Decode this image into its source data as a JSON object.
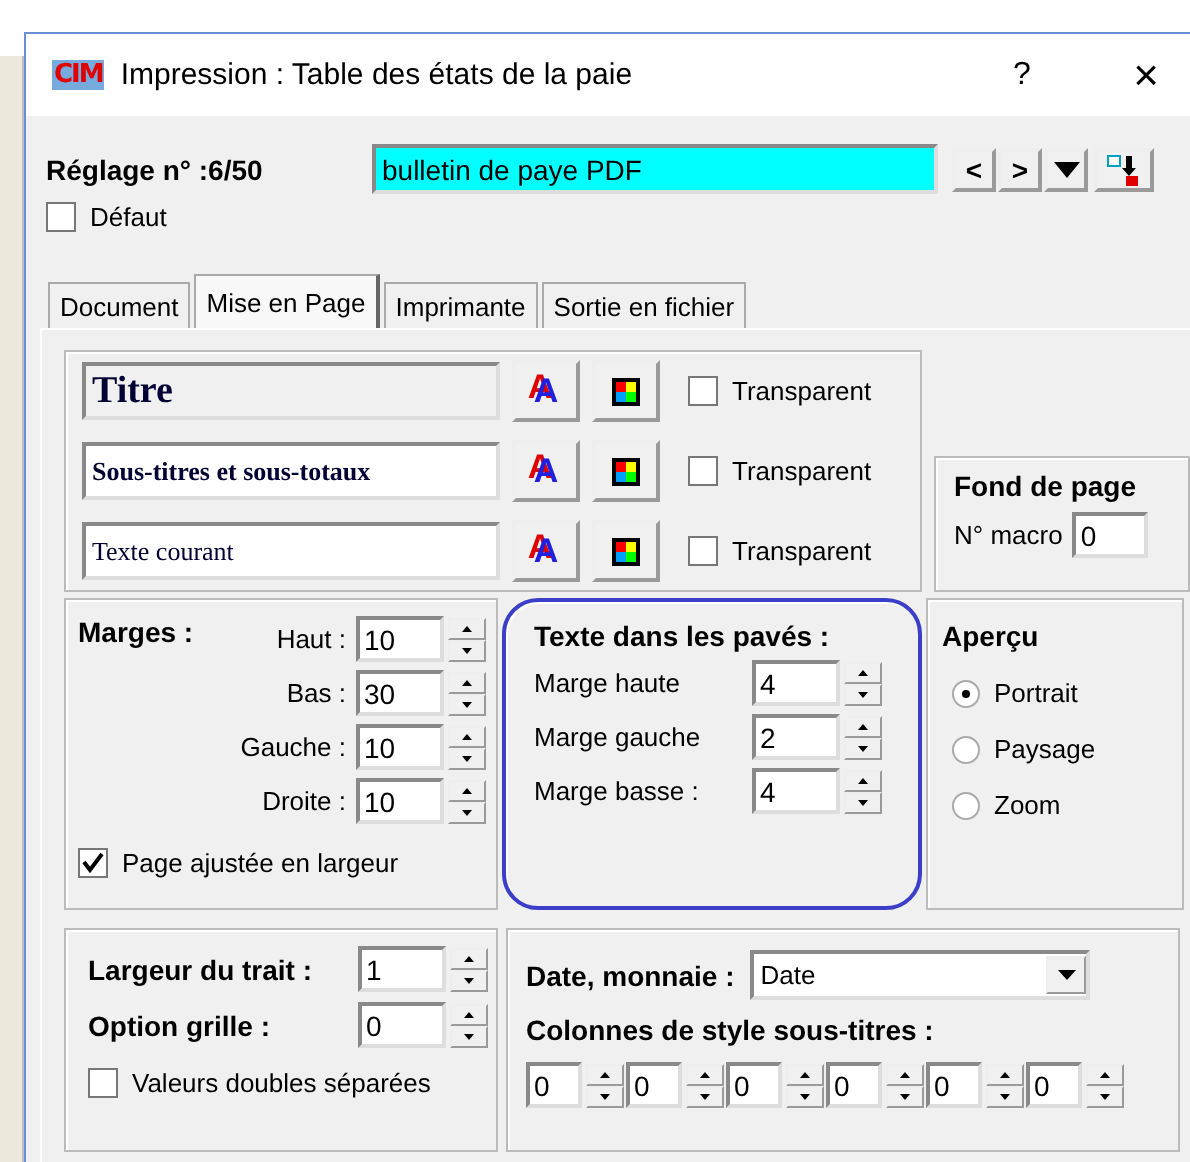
{
  "window": {
    "logo": "CIM",
    "title": "Impression : Table des états de la paie",
    "help": "?",
    "close": "×"
  },
  "preset": {
    "label": "Réglage n° :6/50",
    "value": "bulletin de paye PDF",
    "prev": "<",
    "next": ">",
    "default": {
      "label": "Défaut",
      "checked": false
    }
  },
  "tabs": [
    {
      "label": "Document",
      "selected": false
    },
    {
      "label": "Mise en Page",
      "selected": true
    },
    {
      "label": "Imprimante",
      "selected": false
    },
    {
      "label": "Sortie en fichier",
      "selected": false
    }
  ],
  "styles": [
    {
      "name": "Titre",
      "kind": "title",
      "font_glyph": "A",
      "transparent": {
        "label": "Transparent",
        "checked": false
      }
    },
    {
      "name": "Sous-titres et sous-totaux",
      "kind": "subtitle",
      "font_glyph": "A",
      "transparent": {
        "label": "Transparent",
        "checked": false
      }
    },
    {
      "name": "Texte courant",
      "kind": "body",
      "font_glyph": "A",
      "transparent": {
        "label": "Transparent",
        "checked": false
      }
    }
  ],
  "background": {
    "title": "Fond de page",
    "macro_label": "N° macro",
    "macro_value": "0"
  },
  "margins": {
    "title": "Marges :",
    "fields": [
      {
        "label": "Haut :",
        "value": "10"
      },
      {
        "label": "Bas :",
        "value": "30"
      },
      {
        "label": "Gauche :",
        "value": "10"
      },
      {
        "label": "Droite :",
        "value": "10"
      }
    ],
    "fit_width": {
      "label": "Page ajustée en largeur",
      "checked": true
    }
  },
  "text_in_blocks": {
    "title": "Texte dans les pavés :",
    "highlighted": true,
    "fields": [
      {
        "label": "Marge haute",
        "value": "4"
      },
      {
        "label": "Marge gauche",
        "value": "2"
      },
      {
        "label": "Marge basse :",
        "value": "4"
      }
    ]
  },
  "preview": {
    "title": "Aperçu",
    "options": [
      {
        "label": "Portrait",
        "selected": true
      },
      {
        "label": "Paysage",
        "selected": false
      },
      {
        "label": "Zoom",
        "selected": false
      }
    ]
  },
  "lines": {
    "width_label": "Largeur du trait :",
    "width_value": "1",
    "grid_label": "Option grille :",
    "grid_value": "0",
    "double_values": {
      "label": "Valeurs doubles séparées",
      "checked": false
    }
  },
  "date": {
    "label": "Date, monnaie :",
    "value": "Date",
    "columns_title": "Colonnes de style sous-titres :",
    "columns": [
      "0",
      "0",
      "0",
      "0",
      "0",
      "0"
    ]
  }
}
